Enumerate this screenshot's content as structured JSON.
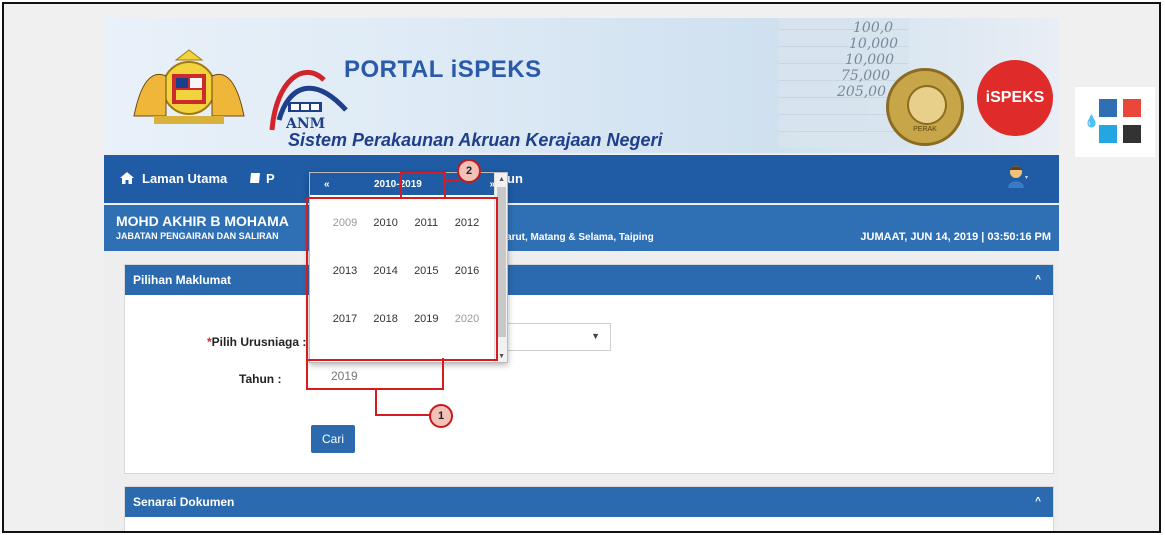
{
  "header": {
    "title": "PORTAL iSPEKS",
    "subtitle": "Sistem Perakaunan Akruan Kerajaan Negeri",
    "anm_text": "ANM",
    "brand_badge": "iSPEKS",
    "seal_text": "PERAK",
    "ledger_numbers": [
      "100,0",
      "10,000",
      "10,000",
      "75,000",
      "205,00"
    ]
  },
  "navbar": {
    "home": "Laman Utama",
    "item2_prefix": "P",
    "item3_suffix": "run"
  },
  "user": {
    "name": "MOHD AKHIR B MOHAMA",
    "dept": "JABATAN PENGAIRAN DAN SALIRAN",
    "location": "Larut, Matang & Selama, Taiping",
    "datetime": "JUMAAT, JUN 14, 2019 | 03:50:16 PM"
  },
  "panel_info": {
    "title": "Pilihan Maklumat",
    "label_urusniaga": "Pilih Urusniaga :",
    "required_mark": "*",
    "label_tahun": "Tahun :",
    "tahun_value": "2019",
    "search_button": "Cari"
  },
  "panel_docs": {
    "title": "Senarai Dokumen"
  },
  "datepicker": {
    "prev": "«",
    "next": "»",
    "range": "2010-2019",
    "years": [
      [
        "2009",
        "2010",
        "2011",
        "2012"
      ],
      [
        "2013",
        "2014",
        "2015",
        "2016"
      ],
      [
        "2017",
        "2018",
        "2019",
        "2020"
      ]
    ]
  },
  "callouts": {
    "one": "1",
    "two": "2"
  },
  "colors": {
    "nav_blue": "#1f5ca5",
    "panel_blue": "#2b6aae",
    "highlight_red": "#d81b20",
    "swatches": [
      "#2f6fb4",
      "#e8473a",
      "#24a7e0",
      "#333333"
    ]
  },
  "icons": {
    "home": "home-icon",
    "user": "user-icon",
    "theme": "drop-icon",
    "caret": "chevron-up-icon"
  }
}
